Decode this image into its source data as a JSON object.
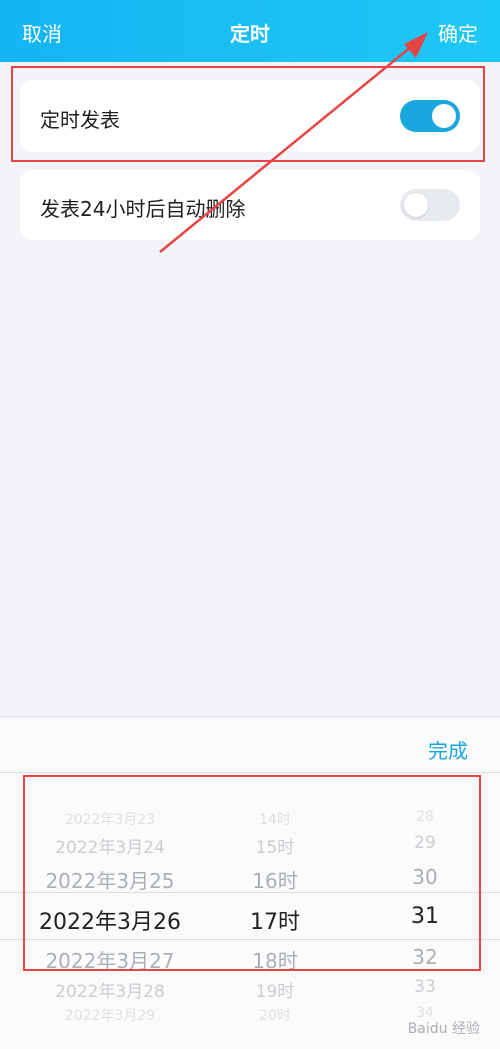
{
  "header": {
    "cancel": "取消",
    "title": "定时",
    "confirm": "确定"
  },
  "settings": [
    {
      "label": "定时发表",
      "enabled": true
    },
    {
      "label": "发表24小时后自动删除",
      "enabled": false
    }
  ],
  "picker": {
    "done": "完成",
    "dates": [
      "2022年3月23",
      "2022年3月24",
      "2022年3月25",
      "2022年3月26",
      "2022年3月27",
      "2022年3月28",
      "2022年3月29"
    ],
    "hours": [
      "14时",
      "15时",
      "16时",
      "17时",
      "18时",
      "19时",
      "20时"
    ],
    "minutes": [
      "28",
      "29",
      "30",
      "31",
      "32",
      "33",
      "34"
    ],
    "selected": {
      "date": "2022年3月26",
      "hour": "17时",
      "minute": "31"
    }
  },
  "watermark": "Baidu 经验",
  "colors": {
    "header": "#16b4f3",
    "accent": "#1aa7df",
    "annotation": "#e64545"
  }
}
